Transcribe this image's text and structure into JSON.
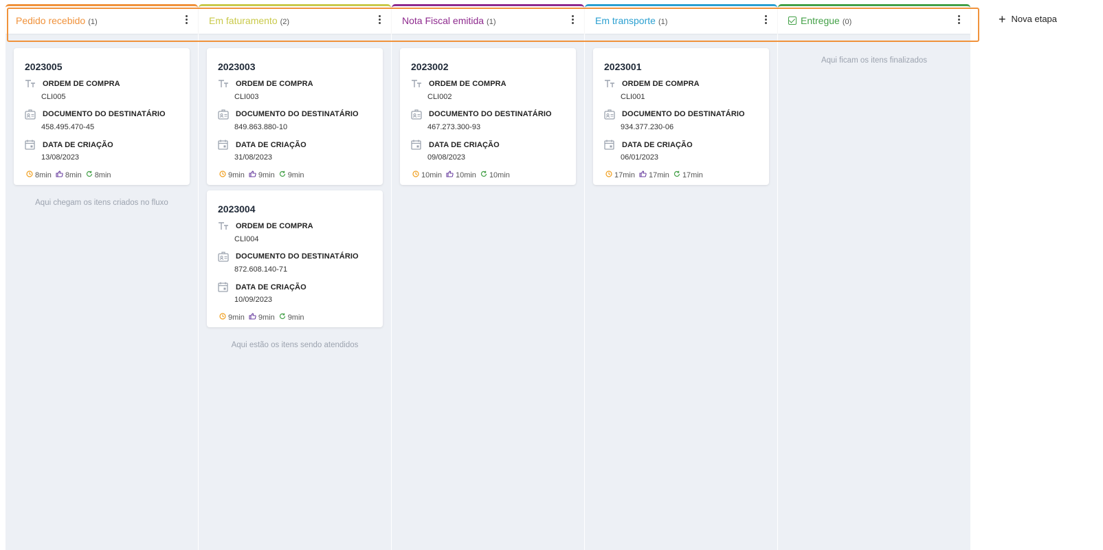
{
  "columns": [
    {
      "title": "Pedido recebido",
      "count": "(1)",
      "color": "#f0923b",
      "cards": [
        {
          "number": "2023005",
          "order_label": "ORDEM DE COMPRA",
          "order": "CLI005",
          "doc_label": "DOCUMENTO DO DESTINATÁRIO",
          "doc": "458.495.470-45",
          "date_label": "DATA DE CRIAÇÃO",
          "date": "13/08/2023",
          "t1": "8min",
          "t2": "8min",
          "t3": "8min"
        }
      ],
      "empty_message": "Aqui chegam os itens criados no fluxo"
    },
    {
      "title": "Em faturamento",
      "count": "(2)",
      "color": "#c9c94a",
      "cards": [
        {
          "number": "2023003",
          "order_label": "ORDEM DE COMPRA",
          "order": "CLI003",
          "doc_label": "DOCUMENTO DO DESTINATÁRIO",
          "doc": "849.863.880-10",
          "date_label": "DATA DE CRIAÇÃO",
          "date": "31/08/2023",
          "t1": "9min",
          "t2": "9min",
          "t3": "9min"
        },
        {
          "number": "2023004",
          "order_label": "ORDEM DE COMPRA",
          "order": "CLI004",
          "doc_label": "DOCUMENTO DO DESTINATÁRIO",
          "doc": "872.608.140-71",
          "date_label": "DATA DE CRIAÇÃO",
          "date": "10/09/2023",
          "t1": "9min",
          "t2": "9min",
          "t3": "9min"
        }
      ],
      "empty_message": "Aqui estão os itens sendo atendidos"
    },
    {
      "title": "Nota Fiscal emitida",
      "count": "(1)",
      "color": "#8e2a8e",
      "cards": [
        {
          "number": "2023002",
          "order_label": "ORDEM DE COMPRA",
          "order": "CLI002",
          "doc_label": "DOCUMENTO DO DESTINATÁRIO",
          "doc": "467.273.300-93",
          "date_label": "DATA DE CRIAÇÃO",
          "date": "09/08/2023",
          "t1": "10min",
          "t2": "10min",
          "t3": "10min"
        }
      ],
      "empty_message": ""
    },
    {
      "title": "Em transporte",
      "count": "(1)",
      "color": "#2a9fd0",
      "cards": [
        {
          "number": "2023001",
          "order_label": "ORDEM DE COMPRA",
          "order": "CLI001",
          "doc_label": "DOCUMENTO DO DESTINATÁRIO",
          "doc": "934.377.230-06",
          "date_label": "DATA DE CRIAÇÃO",
          "date": "06/01/2023",
          "t1": "17min",
          "t2": "17min",
          "t3": "17min"
        }
      ],
      "empty_message": ""
    },
    {
      "title": "Entregue",
      "count": "(0)",
      "color": "#43a047",
      "cards": [],
      "empty_message": "Aqui ficam os itens finalizados"
    }
  ],
  "new_stage_label": "Nova etapa",
  "timer_colors": {
    "clock": "#f0a020",
    "hand": "#6a3fa0",
    "refresh": "#43a047"
  },
  "highlight_color": "#f0923b"
}
